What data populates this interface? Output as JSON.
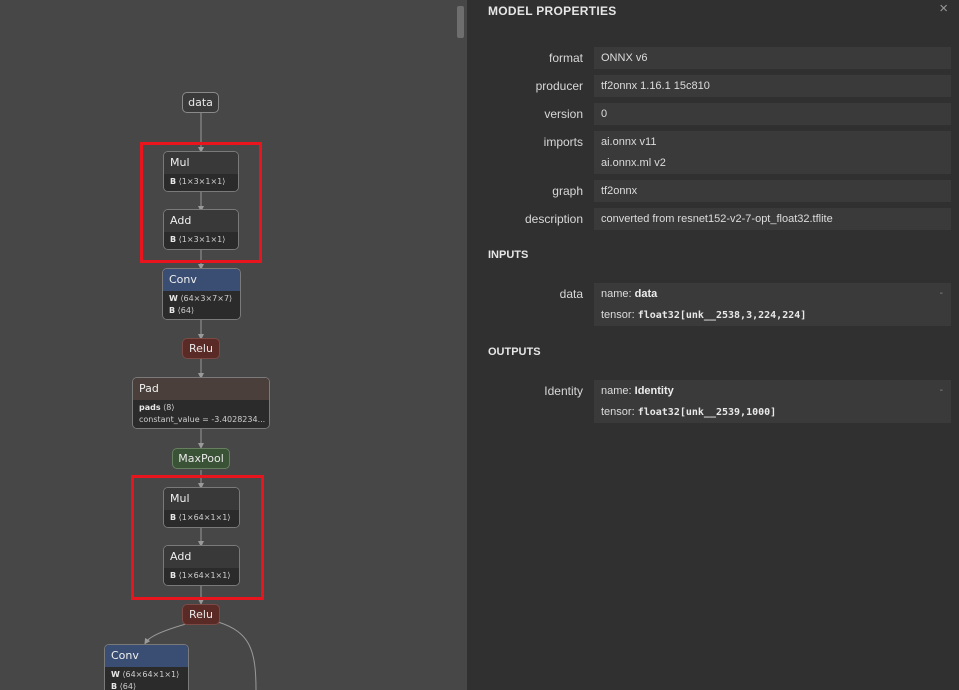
{
  "graph": {
    "nodes": {
      "data": "data",
      "mul1": {
        "op": "Mul",
        "attr_name": "B",
        "attr_value": "⟨1×3×1×1⟩"
      },
      "add1": {
        "op": "Add",
        "attr_name": "B",
        "attr_value": "⟨1×3×1×1⟩"
      },
      "conv1": {
        "op": "Conv",
        "w_name": "W",
        "w_value": "⟨64×3×7×7⟩",
        "b_name": "B",
        "b_value": "⟨64⟩"
      },
      "relu1": "Relu",
      "pad": {
        "op": "Pad",
        "pads_name": "pads",
        "pads_value": "⟨8⟩",
        "const_text": "constant_value = -3.4028234..."
      },
      "maxpool": "MaxPool",
      "mul2": {
        "op": "Mul",
        "attr_name": "B",
        "attr_value": "⟨1×64×1×1⟩"
      },
      "add2": {
        "op": "Add",
        "attr_name": "B",
        "attr_value": "⟨1×64×1×1⟩"
      },
      "relu2": "Relu",
      "conv2": {
        "op": "Conv",
        "w_name": "W",
        "w_value": "⟨64×64×1×1⟩",
        "b_name": "B",
        "b_value": "⟨64⟩"
      }
    },
    "highlight_color": "#e8141e"
  },
  "sidebar": {
    "title": "MODEL PROPERTIES",
    "close_icon": "×",
    "properties": [
      {
        "name": "format",
        "values": [
          "ONNX v6"
        ]
      },
      {
        "name": "producer",
        "values": [
          "tf2onnx 1.16.1 15c810"
        ]
      },
      {
        "name": "version",
        "values": [
          "0"
        ]
      },
      {
        "name": "imports",
        "values": [
          "ai.onnx v11",
          "ai.onnx.ml v2"
        ]
      },
      {
        "name": "graph",
        "values": [
          "tf2onnx"
        ]
      },
      {
        "name": "description",
        "values": [
          "converted from resnet152-v2-7-opt_float32.tflite"
        ]
      }
    ],
    "inputs_title": "INPUTS",
    "inputs": [
      {
        "name": "data",
        "name_label": "name:",
        "name_value": "data",
        "tensor_label": "tensor:",
        "tensor_value": "float32[unk__2538,3,224,224]",
        "expand": "-"
      }
    ],
    "outputs_title": "OUTPUTS",
    "outputs": [
      {
        "name": "Identity",
        "name_label": "name:",
        "name_value": "Identity",
        "tensor_label": "tensor:",
        "tensor_value": "float32[unk__2539,1000]",
        "expand": "-"
      }
    ]
  }
}
